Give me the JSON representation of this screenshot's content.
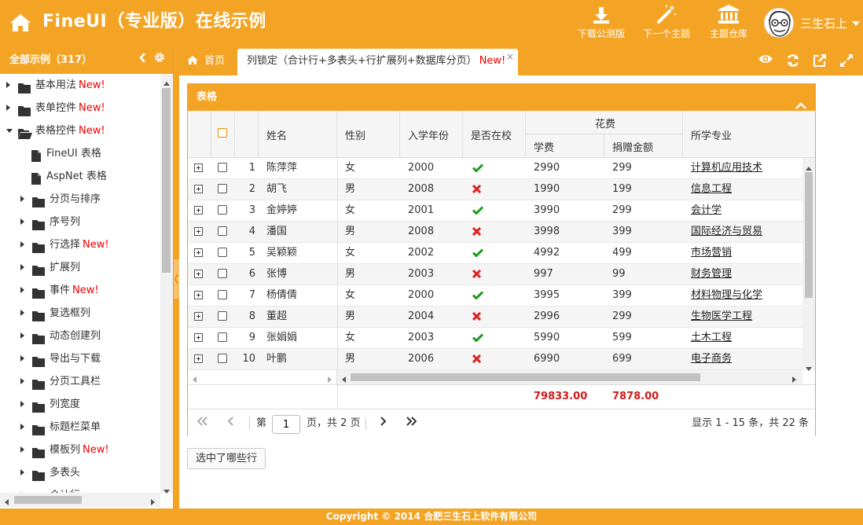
{
  "header": {
    "title": "FineUI（专业版）在线示例",
    "buttons": [
      {
        "label": "下载公测版",
        "icon": "download-icon"
      },
      {
        "label": "下一个主题",
        "icon": "magic-wand-icon"
      },
      {
        "label": "主题仓库",
        "icon": "bank-icon"
      }
    ],
    "user": "三生石上"
  },
  "sidebar": {
    "title": "全部示例（317）",
    "items": [
      {
        "label": "基本用法",
        "new": "New!",
        "level": 0,
        "state": "collapsed"
      },
      {
        "label": "表单控件",
        "new": "New!",
        "level": 0,
        "state": "collapsed"
      },
      {
        "label": "表格控件",
        "new": "New!",
        "level": 0,
        "state": "expanded"
      },
      {
        "label": "FineUI 表格",
        "new": "",
        "level": 1,
        "state": "leaf"
      },
      {
        "label": "AspNet 表格",
        "new": "",
        "level": 1,
        "state": "leaf"
      },
      {
        "label": "分页与排序",
        "new": "",
        "level": 1,
        "state": "collapsed"
      },
      {
        "label": "序号列",
        "new": "",
        "level": 1,
        "state": "collapsed"
      },
      {
        "label": "行选择",
        "new": "New!",
        "level": 1,
        "state": "collapsed"
      },
      {
        "label": "扩展列",
        "new": "",
        "level": 1,
        "state": "collapsed"
      },
      {
        "label": "事件",
        "new": "New!",
        "level": 1,
        "state": "collapsed"
      },
      {
        "label": "复选框列",
        "new": "",
        "level": 1,
        "state": "collapsed"
      },
      {
        "label": "动态创建列",
        "new": "",
        "level": 1,
        "state": "collapsed"
      },
      {
        "label": "导出与下载",
        "new": "",
        "level": 1,
        "state": "collapsed"
      },
      {
        "label": "分页工具栏",
        "new": "",
        "level": 1,
        "state": "collapsed"
      },
      {
        "label": "列宽度",
        "new": "",
        "level": 1,
        "state": "collapsed"
      },
      {
        "label": "标题栏菜单",
        "new": "",
        "level": 1,
        "state": "collapsed"
      },
      {
        "label": "模板列",
        "new": "New!",
        "level": 1,
        "state": "collapsed"
      },
      {
        "label": "多表头",
        "new": "",
        "level": 1,
        "state": "collapsed"
      },
      {
        "label": "合计行",
        "new": "",
        "level": 1,
        "state": "collapsed"
      }
    ]
  },
  "tabs": {
    "home": "首页",
    "active": "列锁定（合计行+多表头+行扩展列+数据库分页）",
    "active_new": "New!",
    "close": "×"
  },
  "panel": {
    "title": "表格",
    "headers": {
      "name": "姓名",
      "gender": "性别",
      "year": "入学年份",
      "atschool": "是否在校",
      "cost": "花费",
      "fee": "学费",
      "donate": "捐赠金额",
      "major": "所学专业"
    },
    "rows": [
      {
        "no": "1",
        "name": "陈萍萍",
        "gender": "女",
        "year": "2000",
        "atschool": true,
        "fee": "2990",
        "donate": "299",
        "major": "计算机应用技术"
      },
      {
        "no": "2",
        "name": "胡飞",
        "gender": "男",
        "year": "2008",
        "atschool": false,
        "fee": "1990",
        "donate": "199",
        "major": "信息工程"
      },
      {
        "no": "3",
        "name": "金婷婷",
        "gender": "女",
        "year": "2001",
        "atschool": true,
        "fee": "3990",
        "donate": "299",
        "major": "会计学"
      },
      {
        "no": "4",
        "name": "潘国",
        "gender": "男",
        "year": "2008",
        "atschool": false,
        "fee": "3998",
        "donate": "399",
        "major": "国际经济与贸易"
      },
      {
        "no": "5",
        "name": "吴颖颖",
        "gender": "女",
        "year": "2002",
        "atschool": true,
        "fee": "4992",
        "donate": "499",
        "major": "市场营销"
      },
      {
        "no": "6",
        "name": "张博",
        "gender": "男",
        "year": "2003",
        "atschool": false,
        "fee": "997",
        "donate": "99",
        "major": "财务管理"
      },
      {
        "no": "7",
        "name": "杨倩倩",
        "gender": "女",
        "year": "2000",
        "atschool": true,
        "fee": "3995",
        "donate": "399",
        "major": "材料物理与化学"
      },
      {
        "no": "8",
        "name": "董超",
        "gender": "男",
        "year": "2004",
        "atschool": false,
        "fee": "2996",
        "donate": "299",
        "major": "生物医学工程"
      },
      {
        "no": "9",
        "name": "张娟娟",
        "gender": "女",
        "year": "2003",
        "atschool": true,
        "fee": "5990",
        "donate": "599",
        "major": "土木工程"
      },
      {
        "no": "10",
        "name": "叶鹏",
        "gender": "男",
        "year": "2006",
        "atschool": false,
        "fee": "6990",
        "donate": "699",
        "major": "电子商务"
      }
    ],
    "summary": {
      "fee": "79833.00",
      "donate": "7878.00"
    },
    "pager": {
      "page_prefix": "第",
      "page_value": "1",
      "page_suffix": "页，共 2 页",
      "info": "显示 1 - 15 条，共 22 条"
    }
  },
  "select_button": "选中了哪些行",
  "footer": "Copyright © 2014 合肥三生石上软件有限公司"
}
